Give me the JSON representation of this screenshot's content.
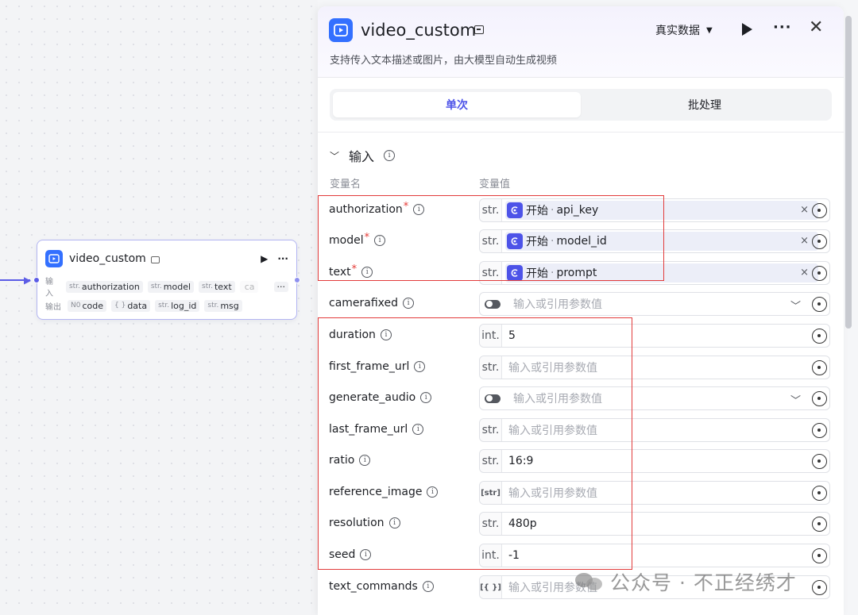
{
  "canvas": {
    "node": {
      "title": "video_custom",
      "input_label": "输入",
      "output_label": "输出",
      "inputs": [
        {
          "type": "str.",
          "name": "authorization"
        },
        {
          "type": "str.",
          "name": "model"
        },
        {
          "type": "str.",
          "name": "text"
        },
        {
          "type": "",
          "name": "ca"
        }
      ],
      "outputs": [
        {
          "type": "N0",
          "name": "code"
        },
        {
          "type": "{ }",
          "name": "data"
        },
        {
          "type": "str.",
          "name": "log_id"
        },
        {
          "type": "str.",
          "name": "msg"
        }
      ],
      "more": "···"
    }
  },
  "panel": {
    "title": "video_custom",
    "description": "支持传入文本描述或图片，由大模型自动生成视频",
    "data_mode": "真实数据",
    "more": "···",
    "close": "✕",
    "tabs": [
      {
        "label": "单次",
        "active": true
      },
      {
        "label": "批处理",
        "active": false
      }
    ],
    "section": {
      "title": "输入",
      "col_name": "变量名",
      "col_value": "变量值"
    },
    "params": [
      {
        "name": "authorization",
        "required": true,
        "type": "str.",
        "ref": {
          "source": "开始",
          "var": "api_key"
        }
      },
      {
        "name": "model",
        "required": true,
        "type": "str.",
        "ref": {
          "source": "开始",
          "var": "model_id"
        }
      },
      {
        "name": "text",
        "required": true,
        "type": "str.",
        "ref": {
          "source": "开始",
          "var": "prompt"
        }
      },
      {
        "name": "camerafixed",
        "required": false,
        "type": "toggle",
        "placeholder": "输入或引用参数值"
      },
      {
        "name": "duration",
        "required": false,
        "type": "int.",
        "value": "5"
      },
      {
        "name": "first_frame_url",
        "required": false,
        "type": "str.",
        "placeholder": "输入或引用参数值"
      },
      {
        "name": "generate_audio",
        "required": false,
        "type": "toggle",
        "placeholder": "输入或引用参数值"
      },
      {
        "name": "last_frame_url",
        "required": false,
        "type": "str.",
        "placeholder": "输入或引用参数值"
      },
      {
        "name": "ratio",
        "required": false,
        "type": "str.",
        "value": "16:9"
      },
      {
        "name": "reference_image",
        "required": false,
        "type": "[str]",
        "placeholder": "输入或引用参数值"
      },
      {
        "name": "resolution",
        "required": false,
        "type": "str.",
        "value": "480p"
      },
      {
        "name": "seed",
        "required": false,
        "type": "int.",
        "value": "-1"
      },
      {
        "name": "text_commands",
        "required": false,
        "type": "[{ }]",
        "placeholder": "输入或引用参数值"
      }
    ],
    "ref_separator": "·",
    "required_mark": "*",
    "info_glyph": "i",
    "clear_glyph": "×"
  },
  "watermark": {
    "text": "公众号 · 不正经绣才"
  },
  "colors": {
    "accent": "#4d53e8",
    "brand_blue": "#3370ff",
    "highlight_red": "#e23b3b"
  }
}
